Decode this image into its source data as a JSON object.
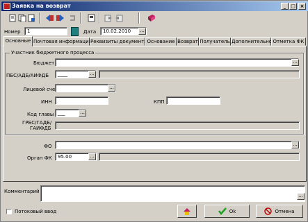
{
  "window": {
    "title": "Заявка на возврат",
    "controls": {
      "minimize": "_",
      "maximize": "□",
      "close": "×"
    }
  },
  "toolbar": {
    "icons": [
      "new-doc-icon",
      "copy-doc-icon",
      "forward-icon",
      "back-icon",
      "refresh-icon",
      "doc-view-icon",
      "export-icon",
      "import-icon",
      "book-icon"
    ]
  },
  "header": {
    "number_label": "Номер",
    "number_value": "1",
    "date_label": "Дата",
    "date_value": "10.02.2010",
    "ellipsis": "..."
  },
  "tabs": [
    {
      "label": "Основные",
      "active": true
    },
    {
      "label": "Почтовая информация"
    },
    {
      "label": "Реквизиты документа"
    },
    {
      "label": "Основание"
    },
    {
      "label": "Возврат"
    },
    {
      "label": "Получатель"
    },
    {
      "label": "Дополнительно"
    },
    {
      "label": "Отметка ФК"
    }
  ],
  "group": {
    "title": "Участник бюджетного процесса",
    "budget_label": "Бюджет",
    "pbs_label": "ПБС/АДБ/АИФДБ",
    "pbs_value": "____",
    "account_label": "Лицевой счет",
    "inn_label": "ИНН",
    "kpp_label": "КПП",
    "chapter_label": "Код главы",
    "chapter_value": "___",
    "grbs_label_1": "ГРБС/ГАДБ/",
    "grbs_label_2": "ГАИФДБ"
  },
  "fo": {
    "fo_label": "ФО",
    "organ_label": "Орган ФК",
    "organ_value": "95.00"
  },
  "comment_label": "Комментарий",
  "footer": {
    "stream_label": "Потоковый ввод",
    "ok_label": "Ok",
    "cancel_label": "Отмена"
  },
  "colors": {
    "title_start": "#0a246a",
    "title_end": "#a6caf0",
    "ok_check": "#20a020",
    "cancel_red": "#c00000"
  }
}
